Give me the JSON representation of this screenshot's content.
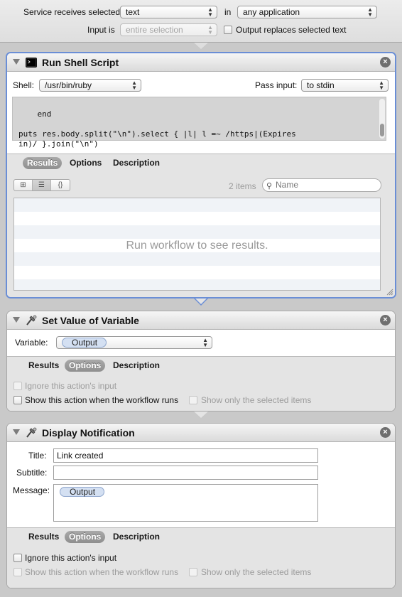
{
  "top": {
    "service_receives_label": "Service receives selected",
    "service_type": "text",
    "in_label": "in",
    "application": "any application",
    "input_is_label": "Input is",
    "input_is_value": "entire selection",
    "output_replaces_label": "Output replaces selected text"
  },
  "run_shell": {
    "title": "Run Shell Script",
    "shell_label": "Shell:",
    "shell_value": "/usr/bin/ruby",
    "pass_input_label": "Pass input:",
    "pass_input_value": "to stdin",
    "code": "end\n\nputs res.body.split(\"\\n\").select { |l| l =~ /https|(Expires\nin)/ }.join(\"\\n\")",
    "tabs": {
      "results": "Results",
      "options": "Options",
      "description": "Description"
    },
    "view_buttons": [
      "⊞",
      "☰",
      "{}"
    ],
    "item_count": "2 items",
    "search_placeholder": "Name",
    "empty_message": "Run workflow to see results."
  },
  "set_variable": {
    "title": "Set Value of Variable",
    "variable_label": "Variable:",
    "variable_value": "Output",
    "tabs": {
      "results": "Results",
      "options": "Options",
      "description": "Description"
    },
    "ignore_input": "Ignore this action's input",
    "show_when_runs": "Show this action when the workflow runs",
    "show_only_selected": "Show only the selected items"
  },
  "notification": {
    "title": "Display Notification",
    "title_label": "Title:",
    "title_value": "Link created",
    "subtitle_label": "Subtitle:",
    "subtitle_value": "",
    "message_label": "Message:",
    "message_token": "Output",
    "tabs": {
      "results": "Results",
      "options": "Options",
      "description": "Description"
    },
    "ignore_input": "Ignore this action's input",
    "show_when_runs": "Show this action when the workflow runs",
    "show_only_selected": "Show only the selected items"
  },
  "icons": {
    "close": "×",
    "search": "⚲"
  },
  "colors": {
    "selection_border": "#6a8ed6",
    "token_bg": "#d4e0f2",
    "code_bg": "#d4d4d4"
  }
}
